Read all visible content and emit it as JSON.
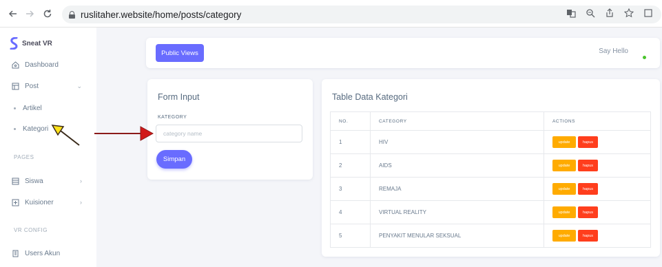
{
  "browser": {
    "url": "ruslitaher.website/home/posts/category",
    "back_icon": "arrow-left",
    "forward_icon": "arrow-right",
    "reload_icon": "reload"
  },
  "sidebar": {
    "brand": "Sneat VR",
    "dashboard": "Dashboard",
    "post": "Post",
    "artikel": "Artikel",
    "kategori": "Kategori",
    "pages_label": "PAGES",
    "siswa": "Siswa",
    "kuisioner": "Kuisioner",
    "vr_config_label": "VR CONFIG",
    "users_akun": "Users Akun"
  },
  "navbar": {
    "public_views": "Public Views",
    "say_hello": "Say Hello",
    "status_color": "#4bc42d"
  },
  "form": {
    "title": "Form Input",
    "label": "KATEGORY",
    "placeholder": "category name",
    "submit": "Simpan"
  },
  "table": {
    "title": "Table Data Kategori",
    "headers": [
      "NO.",
      "CATEGORY",
      "ACTIONS"
    ],
    "update_label": "update",
    "hapus_label": "hapus",
    "rows": [
      {
        "no": "1",
        "category": "HIV"
      },
      {
        "no": "2",
        "category": "AIDS"
      },
      {
        "no": "3",
        "category": "REMAJA"
      },
      {
        "no": "4",
        "category": "VIRTUAL REALITY"
      },
      {
        "no": "5",
        "category": "PENYAKIT MENULAR SEKSUAL"
      }
    ]
  },
  "colors": {
    "primary": "#696cff",
    "update": "#ffab00",
    "delete": "#ff3e1d",
    "annotation_arrow": "#8b1a1a"
  }
}
